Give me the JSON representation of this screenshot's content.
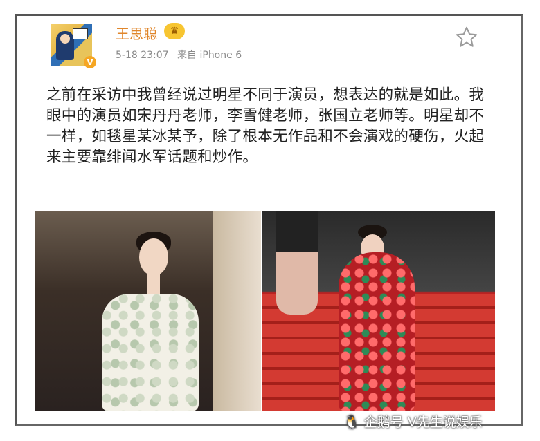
{
  "post": {
    "username": "王思聪",
    "badge_label": "V",
    "crown_symbol": "♛",
    "date": "5-18 23:07",
    "source": "来自 iPhone 6",
    "text": "之前在采访中我曾经说过明星不同于演员，想表达的就是如此。我眼中的演员如宋丹丹老师，李雪健老师，张国立老师等。明星却不一样，如毯星某冰某予，除了根本无作品和不会演戏的硬伤，火起来主要靠绯闻水军话题和炒作。"
  },
  "icons": {
    "favorite": "star-icon",
    "verified": "verified-badge-icon"
  },
  "watermark": {
    "glyph": "🐧",
    "text": "企鹅号 V先生说娱乐"
  },
  "colors": {
    "username": "#e0862b",
    "meta": "#8a8a8a",
    "text": "#222222",
    "badge": "#f5a623"
  }
}
